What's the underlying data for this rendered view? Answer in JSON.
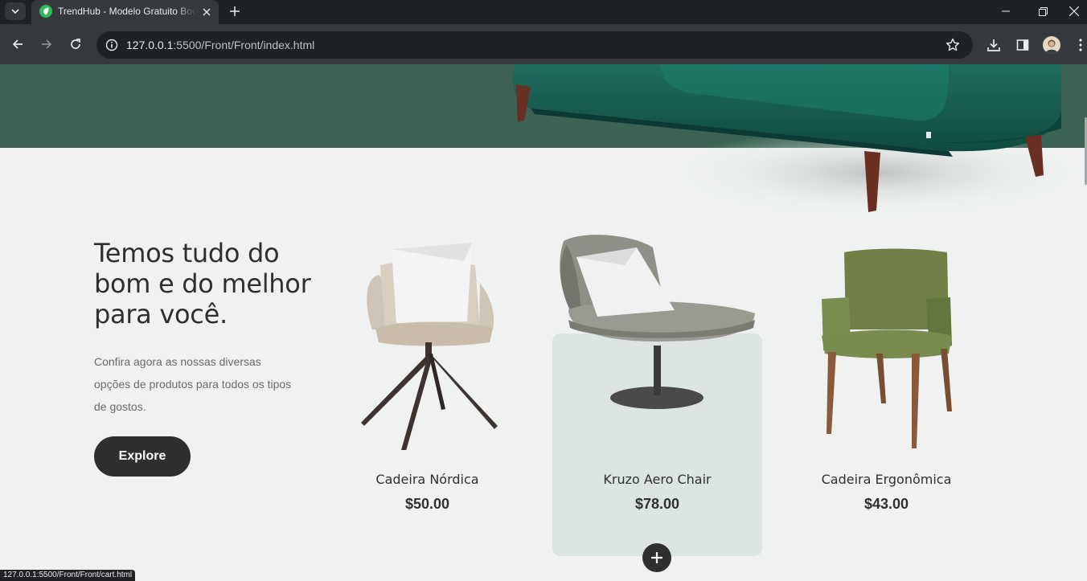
{
  "browser": {
    "tab_title": "TrendHub - Modelo Gratuito Bootstrap",
    "url_host": "127.0.0.1",
    "url_rest": ":5500/Front/Front/index.html",
    "status_url": "127.0.0.1:5500/Front/Front/cart.html"
  },
  "intro": {
    "title": "Temos tudo do bom e do melhor para você.",
    "text": "Confira agora as nossas diversas opções de produtos para todos os tipos de gostos.",
    "button": "Explore"
  },
  "products": [
    {
      "name": "Cadeira Nórdica",
      "price": "$50.00",
      "image": "nordic-chair"
    },
    {
      "name": "Kruzo Aero Chair",
      "price": "$78.00",
      "image": "lounge-chair"
    },
    {
      "name": "Cadeira Ergonômica",
      "price": "$43.00",
      "image": "green-chair"
    }
  ],
  "colors": {
    "hero_green": "#3c6353",
    "page_bg": "#eff2f1",
    "dark": "#2f2f2f",
    "card_bg": "#dce5e3"
  }
}
